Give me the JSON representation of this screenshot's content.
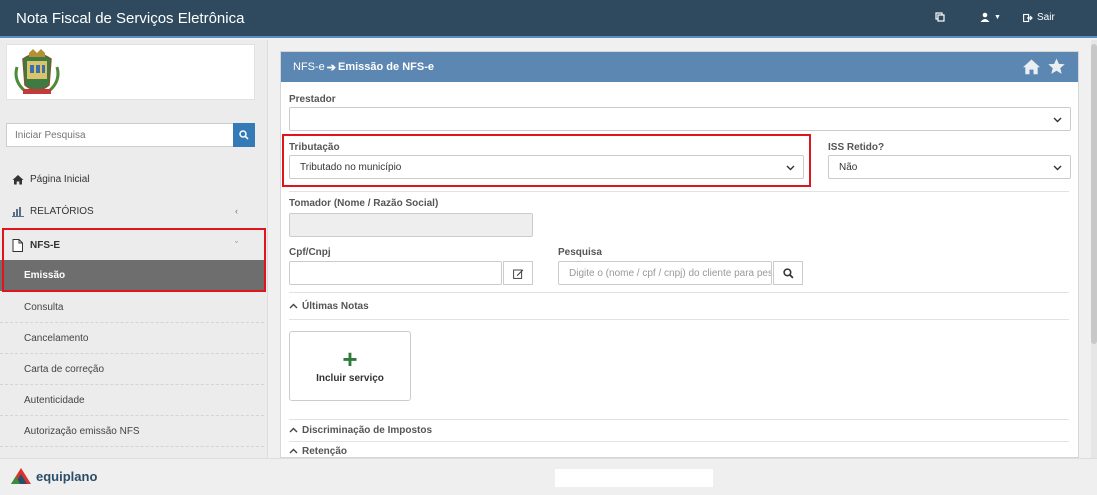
{
  "app": {
    "title": "Nota Fiscal de Serviços Eletrônica"
  },
  "topbar": {
    "copy_icon": "copy-icon",
    "user_icon": "user-icon",
    "logout_label": "Sair"
  },
  "sidebar": {
    "search_placeholder": "Iniciar Pesquisa",
    "home_label": "Página Inicial",
    "reports_label": "RELATÓRIOS",
    "nfse_label": "NFS-E",
    "items": [
      {
        "label": "Emissão",
        "active": true
      },
      {
        "label": "Consulta"
      },
      {
        "label": "Cancelamento"
      },
      {
        "label": "Carta de correção"
      },
      {
        "label": "Autenticidade"
      },
      {
        "label": "Autorização emissão NFS"
      }
    ]
  },
  "panel": {
    "breadcrumb_root": "NFS-e",
    "breadcrumb_current": "Emissão de NFS-e",
    "prestador_label": "Prestador",
    "prestador_value": "",
    "tributacao_label": "Tributação",
    "tributacao_value": "Tributado no município",
    "iss_label": "ISS Retido?",
    "iss_value": "Não",
    "tomador_label": "Tomador (Nome / Razão Social)",
    "cpf_label": "Cpf/Cnpj",
    "pesquisa_label": "Pesquisa",
    "pesquisa_placeholder": "Digite o (nome / cpf / cnpj) do cliente para pesquisar",
    "ultimas_notas": "Últimas Notas",
    "incluir_servico": "Incluir serviço",
    "discriminacao": "Discriminação de Impostos",
    "retencao": "Retenção"
  },
  "footer": {
    "brand": "equiplano"
  },
  "colors": {
    "topbar": "#2f4a5e",
    "panel_header": "#5b87b2",
    "highlight": "#e0141b",
    "active_item": "#6e6e6e"
  }
}
